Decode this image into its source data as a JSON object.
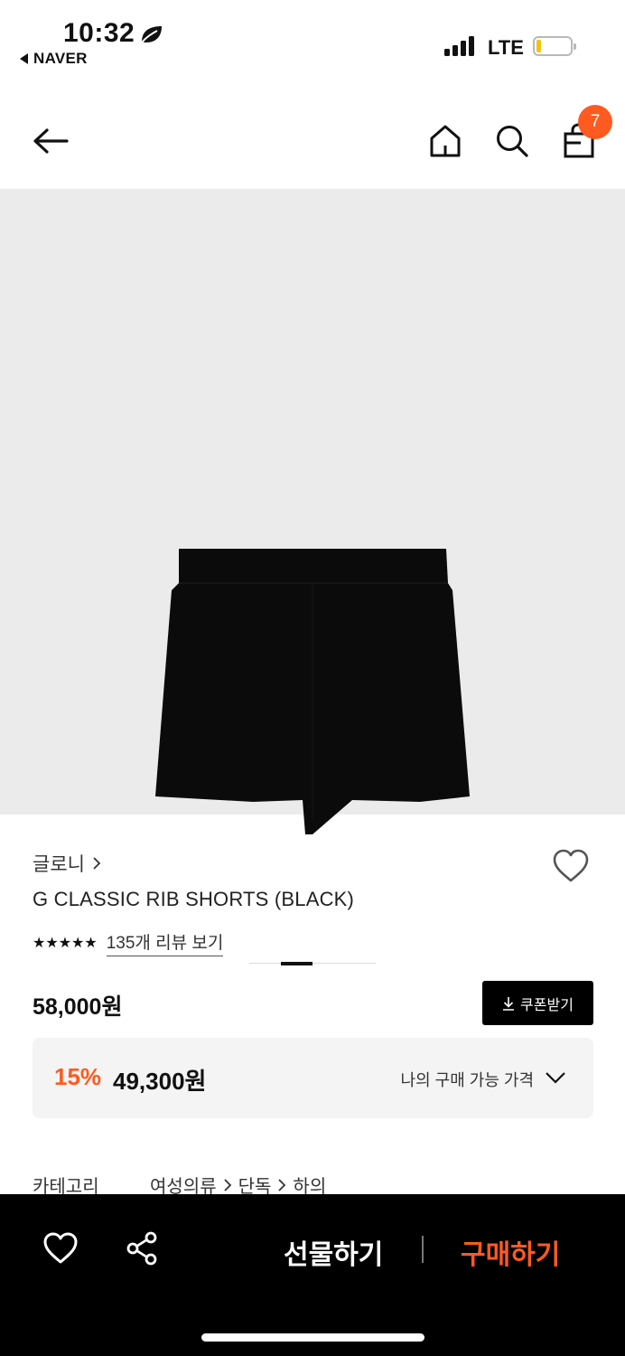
{
  "status_bar": {
    "time": "10:32",
    "back_app": "NAVER",
    "network": "LTE",
    "icons": [
      "leaf-icon",
      "signal-icon",
      "battery-icon"
    ],
    "battery_level_fraction": 0.15
  },
  "nav": {
    "icons": [
      "back-arrow-icon",
      "home-icon",
      "search-icon",
      "shopping-bag-icon"
    ],
    "cart_count": "7"
  },
  "hero": {
    "image_subject": "black shorts",
    "page_indicator": {
      "current": 2,
      "total": 4
    }
  },
  "product": {
    "brand": "글로니",
    "name": "G CLASSIC RIB SHORTS (BLACK)",
    "stars": "★★★★★",
    "review_link": "135개 리뷰 보기",
    "price": "58,000원",
    "coupon_button": "쿠폰받기",
    "discount_rate": "15%",
    "discount_price": "49,300원",
    "my_price_label": "나의 구매 가능 가격",
    "category_label": "카테고리",
    "category_path": [
      "여성의류",
      "단독",
      "하의"
    ]
  },
  "bottom_bar": {
    "gift": "선물하기",
    "buy": "구매하기"
  },
  "colors": {
    "accent": "#ff5a1f",
    "hero_bg": "#ebebeb",
    "bottom_bar_bg": "#000000",
    "discount_box_bg": "#f4f4f4"
  }
}
